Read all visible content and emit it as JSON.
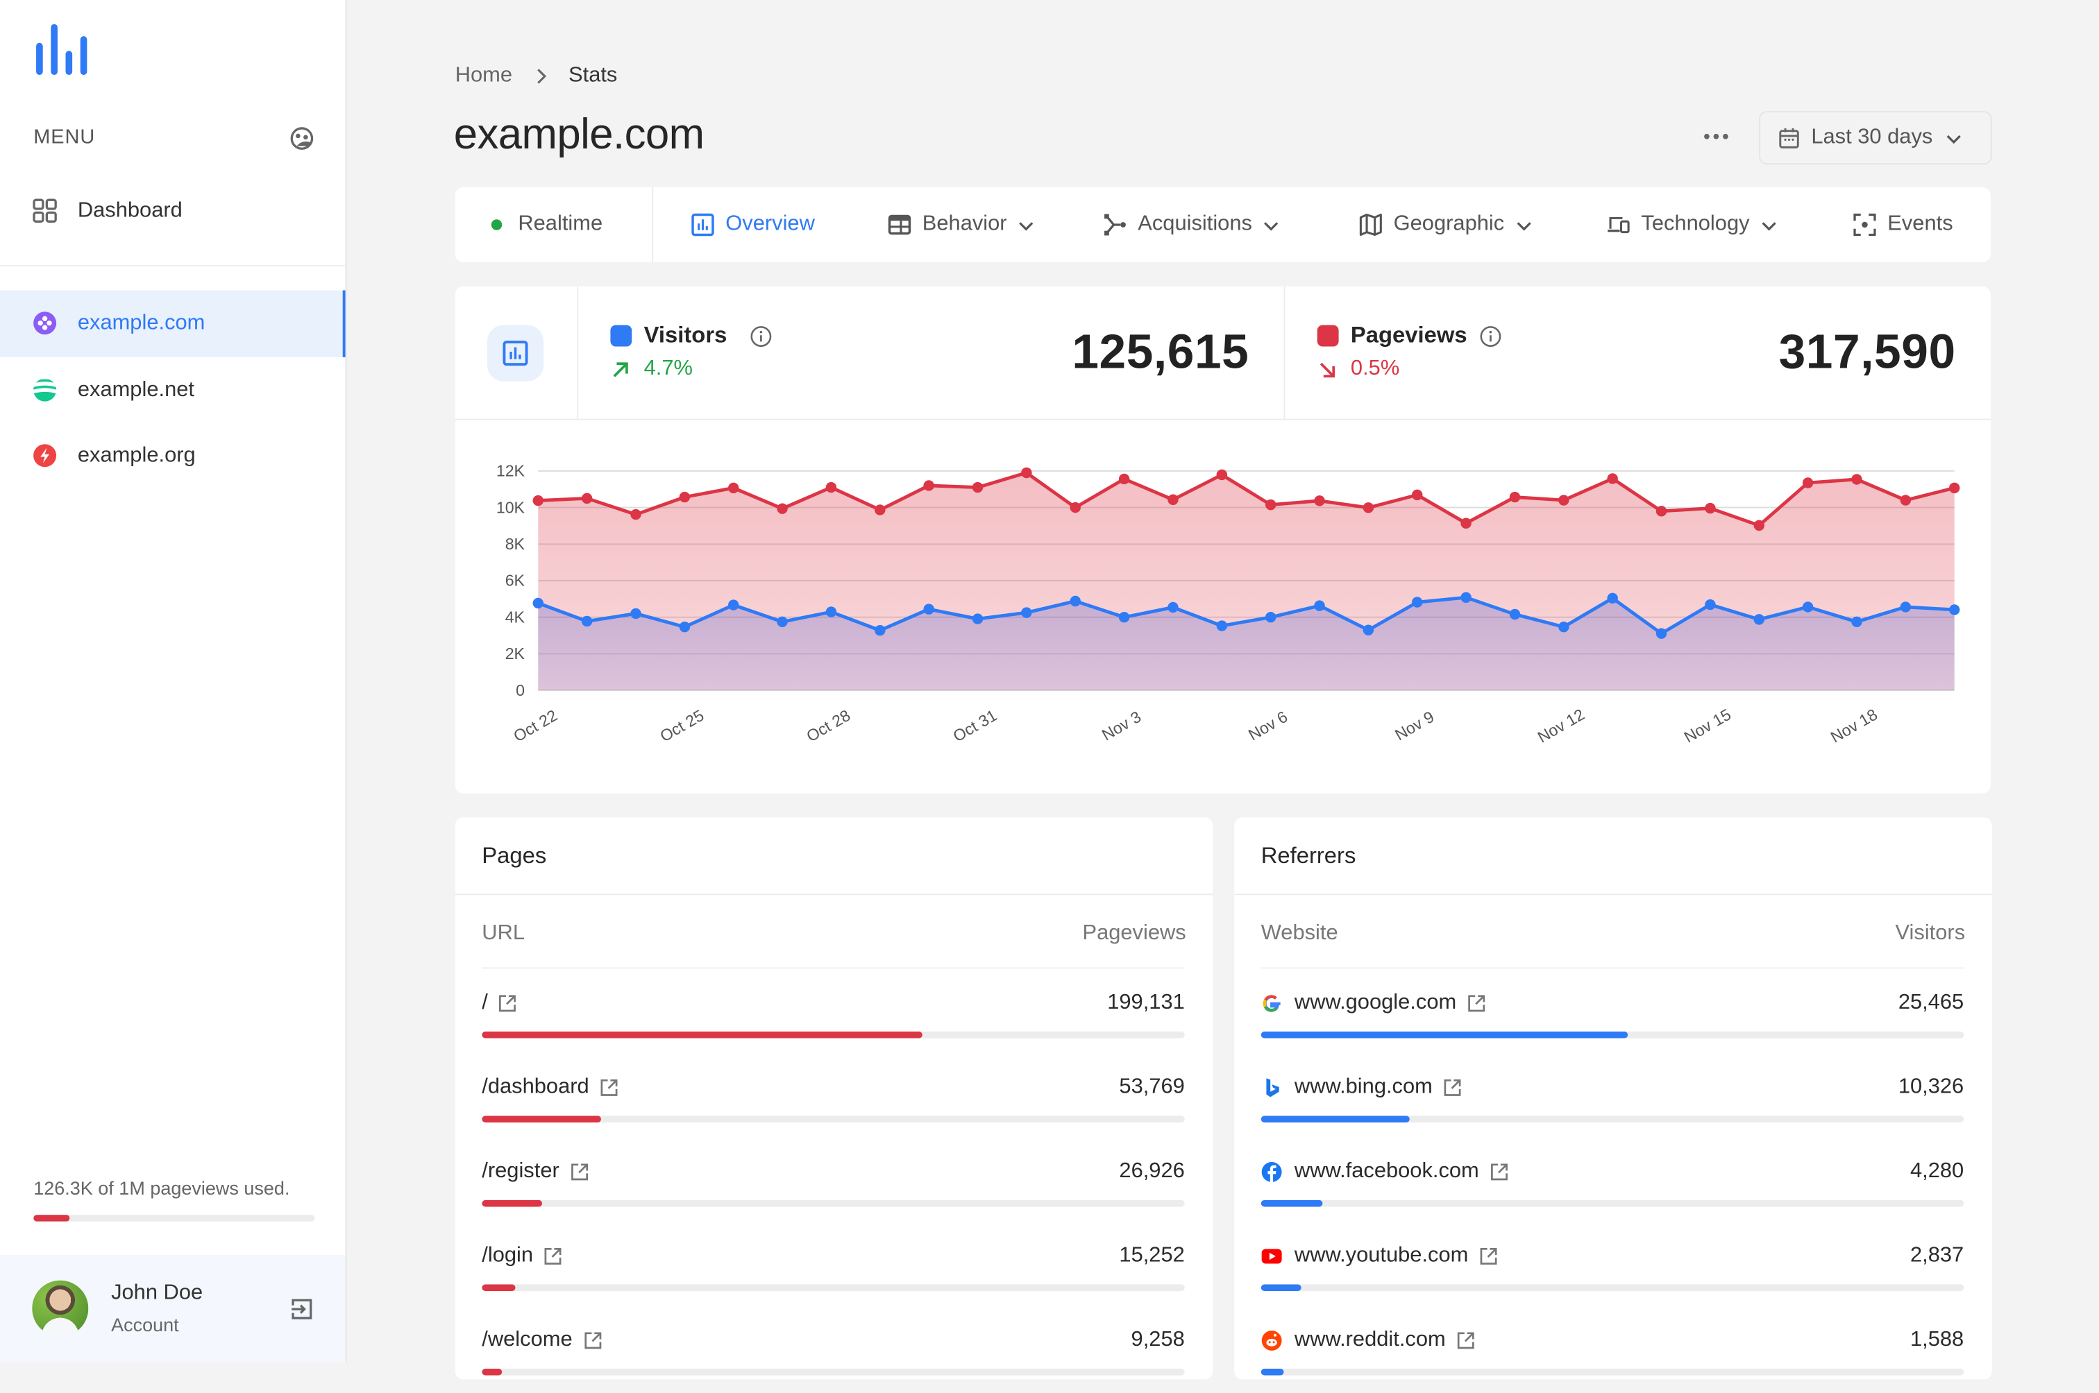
{
  "sidebar": {
    "menu_label": "MENU",
    "nav": [
      {
        "label": "Dashboard",
        "icon": "grid-icon"
      }
    ],
    "sites": [
      {
        "label": "example.com",
        "icon": "site-purple-icon",
        "color": "#8b5cf6",
        "active": true
      },
      {
        "label": "example.net",
        "icon": "site-green-icon",
        "color": "#10c98f",
        "active": false
      },
      {
        "label": "example.org",
        "icon": "site-red-icon",
        "color": "#ef4444",
        "active": false
      }
    ],
    "usage": {
      "text": "126.3K of 1M pageviews used.",
      "fraction": 0.1263
    },
    "account": {
      "name": "John Doe",
      "subtitle": "Account"
    }
  },
  "header": {
    "breadcrumb": [
      {
        "label": "Home"
      },
      {
        "label": "Stats"
      }
    ],
    "title": "example.com",
    "date_range": "Last 30 days"
  },
  "tabs": [
    {
      "label": "Realtime",
      "icon": "live-dot-icon",
      "dropdown": false,
      "active": false
    },
    {
      "label": "Overview",
      "icon": "chart-bar-icon",
      "dropdown": false,
      "active": true
    },
    {
      "label": "Behavior",
      "icon": "layout-icon",
      "dropdown": true,
      "active": false
    },
    {
      "label": "Acquisitions",
      "icon": "branch-icon",
      "dropdown": true,
      "active": false
    },
    {
      "label": "Geographic",
      "icon": "map-icon",
      "dropdown": true,
      "active": false
    },
    {
      "label": "Technology",
      "icon": "devices-icon",
      "dropdown": true,
      "active": false
    },
    {
      "label": "Events",
      "icon": "focus-icon",
      "dropdown": false,
      "active": false
    }
  ],
  "stats": {
    "visitors": {
      "label": "Visitors",
      "value": "125,615",
      "delta": "4.7%",
      "direction": "up",
      "color": "#2f7af5",
      "delta_color": "#22a447"
    },
    "pageviews": {
      "label": "Pageviews",
      "value": "317,590",
      "delta": "0.5%",
      "direction": "down",
      "color": "#dc3545",
      "delta_color": "#dc3545"
    }
  },
  "chart_data": {
    "type": "area",
    "title": "",
    "xlabel": "",
    "ylabel": "",
    "ylim": [
      0,
      12000
    ],
    "yticks": [
      0,
      2000,
      4000,
      6000,
      8000,
      10000,
      12000
    ],
    "ytick_labels": [
      "0",
      "2K",
      "4K",
      "6K",
      "8K",
      "10K",
      "12K"
    ],
    "x": [
      "Oct 22",
      "Oct 23",
      "Oct 24",
      "Oct 25",
      "Oct 26",
      "Oct 27",
      "Oct 28",
      "Oct 29",
      "Oct 30",
      "Oct 31",
      "Nov 1",
      "Nov 2",
      "Nov 3",
      "Nov 4",
      "Nov 5",
      "Nov 6",
      "Nov 7",
      "Nov 8",
      "Nov 9",
      "Nov 10",
      "Nov 11",
      "Nov 12",
      "Nov 13",
      "Nov 14",
      "Nov 15",
      "Nov 16",
      "Nov 17",
      "Nov 18",
      "Nov 19",
      "Nov 20"
    ],
    "xtick_labels": [
      "Oct 22",
      "Oct 25",
      "Oct 28",
      "Oct 31",
      "Nov 3",
      "Nov 6",
      "Nov 9",
      "Nov 12",
      "Nov 15",
      "Nov 18"
    ],
    "grid": true,
    "legend": "none",
    "series": [
      {
        "name": "Pageviews",
        "color": "#dc3545",
        "values": [
          10380,
          10500,
          9620,
          10570,
          11070,
          9940,
          11100,
          9870,
          11200,
          11100,
          11900,
          10000,
          11560,
          10430,
          11790,
          10150,
          10370,
          9990,
          10690,
          9140,
          10570,
          10400,
          11580,
          9800,
          9960,
          9020,
          11350,
          11540,
          10400,
          11070
        ]
      },
      {
        "name": "Visitors",
        "color": "#2f7af5",
        "values": [
          4770,
          3780,
          4200,
          3470,
          4670,
          3750,
          4290,
          3280,
          4440,
          3910,
          4250,
          4880,
          4000,
          4540,
          3530,
          4000,
          4630,
          3300,
          4820,
          5080,
          4160,
          3470,
          5040,
          3110,
          4690,
          3880,
          4560,
          3750,
          4560,
          4410
        ]
      }
    ]
  },
  "pages": {
    "title": "Pages",
    "col_left": "URL",
    "col_right": "Pageviews",
    "rows": [
      {
        "name": "/",
        "value": "199,131",
        "fraction": 0.626
      },
      {
        "name": "/dashboard",
        "value": "53,769",
        "fraction": 0.169
      },
      {
        "name": "/register",
        "value": "26,926",
        "fraction": 0.085
      },
      {
        "name": "/login",
        "value": "15,252",
        "fraction": 0.048
      },
      {
        "name": "/welcome",
        "value": "9,258",
        "fraction": 0.029
      }
    ]
  },
  "referrers": {
    "title": "Referrers",
    "col_left": "Website",
    "col_right": "Visitors",
    "rows": [
      {
        "name": "www.google.com",
        "icon": "google-icon",
        "value": "25,465",
        "fraction": 0.521
      },
      {
        "name": "www.bing.com",
        "icon": "bing-icon",
        "value": "10,326",
        "fraction": 0.211
      },
      {
        "name": "www.facebook.com",
        "icon": "facebook-icon",
        "value": "4,280",
        "fraction": 0.087
      },
      {
        "name": "www.youtube.com",
        "icon": "youtube-icon",
        "value": "2,837",
        "fraction": 0.058
      },
      {
        "name": "www.reddit.com",
        "icon": "reddit-icon",
        "value": "1,588",
        "fraction": 0.032
      }
    ]
  }
}
